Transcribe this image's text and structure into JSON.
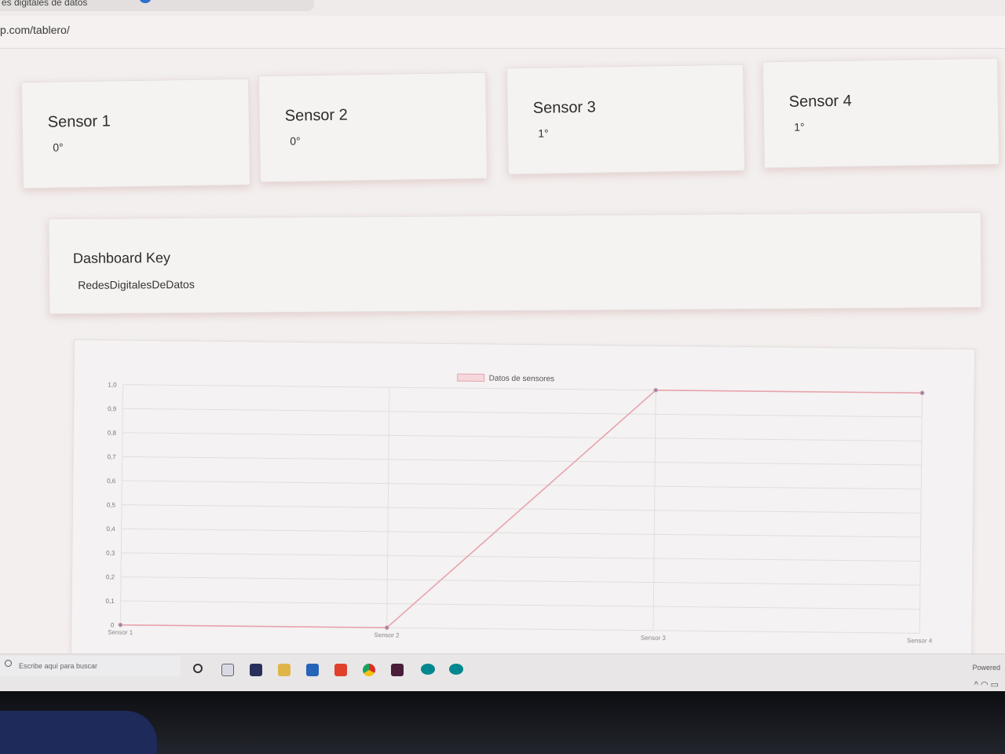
{
  "browser": {
    "tab_title": "es digitales de datos",
    "url": "p.com/tablero/"
  },
  "sensors": [
    {
      "title": "Sensor 1",
      "value": "0°"
    },
    {
      "title": "Sensor 2",
      "value": "0°"
    },
    {
      "title": "Sensor 3",
      "value": "1°"
    },
    {
      "title": "Sensor 4",
      "value": "1°"
    }
  ],
  "dashboard_key": {
    "title": "Dashboard Key",
    "value": "RedesDigitalesDeDatos"
  },
  "chart_data": {
    "type": "line",
    "categories": [
      "Sensor 1",
      "Sensor 2",
      "Sensor 3",
      "Sensor 4"
    ],
    "series": [
      {
        "name": "Datos de sensores",
        "values": [
          0,
          0,
          1,
          1
        ],
        "color": "#e8a3ad"
      }
    ],
    "y_ticks": [
      "0",
      "0,1",
      "0,2",
      "0,3",
      "0,4",
      "0,5",
      "0,6",
      "0,7",
      "0,8",
      "0,9",
      "1,0"
    ],
    "ylim": [
      0,
      1
    ],
    "grid": true,
    "legend_position": "top-center"
  },
  "taskbar": {
    "search_placeholder": "Escribe aquí para buscar",
    "powered_text": "Powered",
    "icons": [
      "task-view-icon",
      "widgets-icon",
      "store-icon",
      "file-explorer-icon",
      "mail-icon",
      "office-icon",
      "chrome-icon",
      "app-icon",
      "arduino-icon",
      "arduino-icon-2"
    ]
  },
  "colors": {
    "line": "#e8a3ad",
    "point": "#8a8aa8",
    "page_bg": "#f2efee"
  }
}
